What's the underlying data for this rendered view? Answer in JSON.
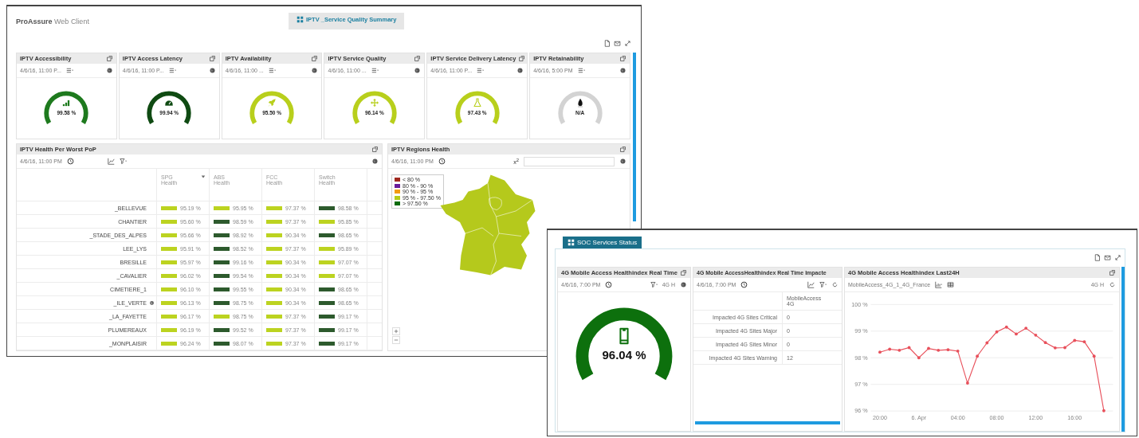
{
  "main_window": {
    "app_title": "**ProAssure** Web Client",
    "tabs": [
      {
        "label": "IPTV _Service Quality Summary",
        "selected": true
      }
    ],
    "gauges": [
      {
        "title": "IPTV Accessibility",
        "date": "4/6/16, 11:00 P...",
        "value": "99.58 %",
        "color": "#1e7a1e",
        "kind": "signal"
      },
      {
        "title": "IPTV Access Latency",
        "date": "4/6/16, 11:00 P...",
        "value": "99.94 %",
        "color": "#0f4a12",
        "kind": "speedometer"
      },
      {
        "title": "IPTV Availability",
        "date": "4/6/16, 11:00 ...",
        "value": "95.50 %",
        "color": "#b8cf1c",
        "kind": "rocket"
      },
      {
        "title": "IPTV Service Quality",
        "date": "4/6/16, 11:00 ...",
        "value": "96.14 %",
        "color": "#b8cf1c",
        "kind": "move"
      },
      {
        "title": "IPTV Service Delivery Latency",
        "date": "4/6/16, 11:00 P...",
        "value": "97.43 %",
        "color": "#b8cf1c",
        "kind": "flask"
      },
      {
        "title": "IPTV Retainability",
        "date": "4/6/16, 5:00 PM",
        "value": "N/A",
        "kind": "flame"
      }
    ],
    "health_table": {
      "title": "IPTV Health Per Worst PoP",
      "date": "4/6/16, 11:00 PM",
      "columns": [
        "SPG Health",
        "ABS Health",
        "FCC Health",
        "Switch Health"
      ],
      "rows": [
        {
          "name": "_BELLEVUE",
          "marked": false,
          "cells": [
            {
              "value": "95.19 %",
              "color": "#bcd320"
            },
            {
              "value": "95.95 %",
              "color": "#bcd320"
            },
            {
              "value": "97.37 %",
              "color": "#bcd320"
            },
            {
              "value": "98.58 %",
              "color": "#2d5a2d"
            }
          ]
        },
        {
          "name": "CHANTIER",
          "marked": false,
          "cells": [
            {
              "value": "95.60 %",
              "color": "#bcd320"
            },
            {
              "value": "98.59 %",
              "color": "#2d5a2d"
            },
            {
              "value": "97.37 %",
              "color": "#bcd320"
            },
            {
              "value": "95.85 %",
              "color": "#bcd320"
            }
          ]
        },
        {
          "name": "_STADE_DES_ALPES",
          "marked": false,
          "cells": [
            {
              "value": "95.66 %",
              "color": "#bcd320"
            },
            {
              "value": "98.92 %",
              "color": "#2d5a2d"
            },
            {
              "value": "90.34 %",
              "color": "#bcd320"
            },
            {
              "value": "98.65 %",
              "color": "#2d5a2d"
            }
          ]
        },
        {
          "name": "LEE_LYS",
          "marked": false,
          "cells": [
            {
              "value": "95.91 %",
              "color": "#bcd320"
            },
            {
              "value": "98.52 %",
              "color": "#2d5a2d"
            },
            {
              "value": "97.37 %",
              "color": "#bcd320"
            },
            {
              "value": "95.89 %",
              "color": "#bcd320"
            }
          ]
        },
        {
          "name": "BRESILLE",
          "marked": false,
          "cells": [
            {
              "value": "95.97 %",
              "color": "#bcd320"
            },
            {
              "value": "99.16 %",
              "color": "#2d5a2d"
            },
            {
              "value": "90.34 %",
              "color": "#bcd320"
            },
            {
              "value": "97.07 %",
              "color": "#bcd320"
            }
          ]
        },
        {
          "name": "_CAVALIER",
          "marked": false,
          "cells": [
            {
              "value": "96.02 %",
              "color": "#bcd320"
            },
            {
              "value": "99.54 %",
              "color": "#2d5a2d"
            },
            {
              "value": "90.34 %",
              "color": "#bcd320"
            },
            {
              "value": "97.07 %",
              "color": "#bcd320"
            }
          ]
        },
        {
          "name": "CIMETIERE_1",
          "marked": false,
          "cells": [
            {
              "value": "96.10 %",
              "color": "#bcd320"
            },
            {
              "value": "99.55 %",
              "color": "#2d5a2d"
            },
            {
              "value": "90.34 %",
              "color": "#bcd320"
            },
            {
              "value": "98.65 %",
              "color": "#2d5a2d"
            }
          ]
        },
        {
          "name": "_ILE_VERTE",
          "marked": true,
          "cells": [
            {
              "value": "96.13 %",
              "color": "#bcd320"
            },
            {
              "value": "98.75 %",
              "color": "#2d5a2d"
            },
            {
              "value": "90.34 %",
              "color": "#bcd320"
            },
            {
              "value": "98.65 %",
              "color": "#2d5a2d"
            }
          ]
        },
        {
          "name": "_LA_FAYETTE",
          "marked": false,
          "cells": [
            {
              "value": "96.17 %",
              "color": "#bcd320"
            },
            {
              "value": "98.75 %",
              "color": "#bcd320"
            },
            {
              "value": "97.37 %",
              "color": "#bcd320"
            },
            {
              "value": "99.17 %",
              "color": "#2d5a2d"
            }
          ]
        },
        {
          "name": "PLUMEREAUX",
          "marked": false,
          "cells": [
            {
              "value": "96.19 %",
              "color": "#bcd320"
            },
            {
              "value": "99.52 %",
              "color": "#2d5a2d"
            },
            {
              "value": "97.37 %",
              "color": "#bcd320"
            },
            {
              "value": "99.17 %",
              "color": "#2d5a2d"
            }
          ]
        },
        {
          "name": "_MONPLAISIR",
          "marked": false,
          "cells": [
            {
              "value": "96.24 %",
              "color": "#bcd320"
            },
            {
              "value": "98.07 %",
              "color": "#2d5a2d"
            },
            {
              "value": "97.37 %",
              "color": "#bcd320"
            },
            {
              "value": "99.17 %",
              "color": "#2d5a2d"
            }
          ]
        }
      ]
    },
    "regions_map": {
      "title": "IPTV Regions Health",
      "date": "4/6/16, 11:00 PM",
      "field_label": "x$^{2}$",
      "legend": [
        {
          "label": "< 80 %",
          "color": "#a0281e"
        },
        {
          "label": "80 % - 90 %",
          "color": "#6a1b9a"
        },
        {
          "label": "90 % - 95 %",
          "color": "#f39c12"
        },
        {
          "label": "95 % - 97.50 %",
          "color": "#b5cc18"
        },
        {
          "label": "> 97.50 %",
          "color": "#0b6b0b"
        }
      ]
    }
  },
  "soc_window": {
    "tabs": [
      {
        "label": "SOC Services Status",
        "selected": true
      }
    ],
    "realtime_panel": {
      "title": "4G Mobile Access Healthindex Real Time",
      "date": "4/6/16, 7:00 PM",
      "unit": "4G H",
      "value": "96.04 %",
      "color": "#0d700d",
      "kind": "phone"
    },
    "impact_panel": {
      "title": "4G Mobile AccessHealthindex Real Time Impacte",
      "date": "4/6/16, 7:00 PM",
      "column": "MobileAccess 4G",
      "rows": [
        {
          "label": "Impacted 4G Sites Critical",
          "value": "0"
        },
        {
          "label": "Impacted 4G Sites Major",
          "value": "0"
        },
        {
          "label": "Impacted 4G Sites Minor",
          "value": "0"
        },
        {
          "label": "Impacted 4G Sites Warning",
          "value": "12"
        }
      ]
    },
    "trend_panel": {
      "title": "4G Mobile Access Healthindex Last24H",
      "unit": "4G H",
      "chart_data": {
        "type": "line",
        "categories": [
          "20:00",
          null,
          null,
          null,
          "6. Apr",
          null,
          null,
          null,
          "04:00",
          null,
          null,
          null,
          "08:00",
          null,
          null,
          null,
          "12:00",
          null,
          null,
          null,
          "16:00",
          null,
          null,
          null
        ],
        "series": [
          {
            "name": "MobileAccess_4G_1_4G_France",
            "color": "#e8505b",
            "values": [
              98.21,
              98.32,
              98.28,
              98.38,
              98.0,
              98.35,
              98.28,
              98.3,
              98.25,
              97.05,
              98.06,
              98.56,
              98.97,
              99.15,
              98.89,
              99.11,
              98.85,
              98.57,
              98.37,
              98.38,
              98.65,
              98.6,
              98.06,
              96.01
            ]
          }
        ],
        "grid": true,
        "ylim": [
          96,
          100
        ],
        "yticks": [
          {
            "value": 96,
            "label": "96 %"
          },
          {
            "value": 97,
            "label": "97 %"
          },
          {
            "value": 98,
            "label": "98 %"
          },
          {
            "value": 99,
            "label": "99 %"
          },
          {
            "value": 100,
            "label": "100 %"
          }
        ]
      }
    }
  }
}
